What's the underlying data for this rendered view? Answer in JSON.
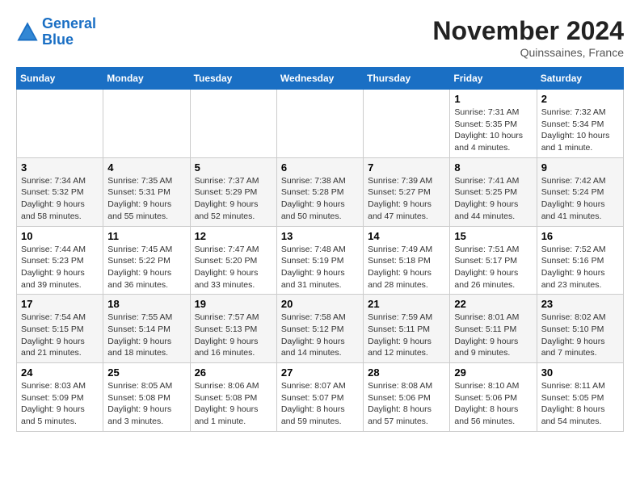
{
  "header": {
    "logo_line1": "General",
    "logo_line2": "Blue",
    "month": "November 2024",
    "location": "Quinssaines, France"
  },
  "weekdays": [
    "Sunday",
    "Monday",
    "Tuesday",
    "Wednesday",
    "Thursday",
    "Friday",
    "Saturday"
  ],
  "weeks": [
    [
      {
        "day": "",
        "info": ""
      },
      {
        "day": "",
        "info": ""
      },
      {
        "day": "",
        "info": ""
      },
      {
        "day": "",
        "info": ""
      },
      {
        "day": "",
        "info": ""
      },
      {
        "day": "1",
        "info": "Sunrise: 7:31 AM\nSunset: 5:35 PM\nDaylight: 10 hours\nand 4 minutes."
      },
      {
        "day": "2",
        "info": "Sunrise: 7:32 AM\nSunset: 5:34 PM\nDaylight: 10 hours\nand 1 minute."
      }
    ],
    [
      {
        "day": "3",
        "info": "Sunrise: 7:34 AM\nSunset: 5:32 PM\nDaylight: 9 hours\nand 58 minutes."
      },
      {
        "day": "4",
        "info": "Sunrise: 7:35 AM\nSunset: 5:31 PM\nDaylight: 9 hours\nand 55 minutes."
      },
      {
        "day": "5",
        "info": "Sunrise: 7:37 AM\nSunset: 5:29 PM\nDaylight: 9 hours\nand 52 minutes."
      },
      {
        "day": "6",
        "info": "Sunrise: 7:38 AM\nSunset: 5:28 PM\nDaylight: 9 hours\nand 50 minutes."
      },
      {
        "day": "7",
        "info": "Sunrise: 7:39 AM\nSunset: 5:27 PM\nDaylight: 9 hours\nand 47 minutes."
      },
      {
        "day": "8",
        "info": "Sunrise: 7:41 AM\nSunset: 5:25 PM\nDaylight: 9 hours\nand 44 minutes."
      },
      {
        "day": "9",
        "info": "Sunrise: 7:42 AM\nSunset: 5:24 PM\nDaylight: 9 hours\nand 41 minutes."
      }
    ],
    [
      {
        "day": "10",
        "info": "Sunrise: 7:44 AM\nSunset: 5:23 PM\nDaylight: 9 hours\nand 39 minutes."
      },
      {
        "day": "11",
        "info": "Sunrise: 7:45 AM\nSunset: 5:22 PM\nDaylight: 9 hours\nand 36 minutes."
      },
      {
        "day": "12",
        "info": "Sunrise: 7:47 AM\nSunset: 5:20 PM\nDaylight: 9 hours\nand 33 minutes."
      },
      {
        "day": "13",
        "info": "Sunrise: 7:48 AM\nSunset: 5:19 PM\nDaylight: 9 hours\nand 31 minutes."
      },
      {
        "day": "14",
        "info": "Sunrise: 7:49 AM\nSunset: 5:18 PM\nDaylight: 9 hours\nand 28 minutes."
      },
      {
        "day": "15",
        "info": "Sunrise: 7:51 AM\nSunset: 5:17 PM\nDaylight: 9 hours\nand 26 minutes."
      },
      {
        "day": "16",
        "info": "Sunrise: 7:52 AM\nSunset: 5:16 PM\nDaylight: 9 hours\nand 23 minutes."
      }
    ],
    [
      {
        "day": "17",
        "info": "Sunrise: 7:54 AM\nSunset: 5:15 PM\nDaylight: 9 hours\nand 21 minutes."
      },
      {
        "day": "18",
        "info": "Sunrise: 7:55 AM\nSunset: 5:14 PM\nDaylight: 9 hours\nand 18 minutes."
      },
      {
        "day": "19",
        "info": "Sunrise: 7:57 AM\nSunset: 5:13 PM\nDaylight: 9 hours\nand 16 minutes."
      },
      {
        "day": "20",
        "info": "Sunrise: 7:58 AM\nSunset: 5:12 PM\nDaylight: 9 hours\nand 14 minutes."
      },
      {
        "day": "21",
        "info": "Sunrise: 7:59 AM\nSunset: 5:11 PM\nDaylight: 9 hours\nand 12 minutes."
      },
      {
        "day": "22",
        "info": "Sunrise: 8:01 AM\nSunset: 5:11 PM\nDaylight: 9 hours\nand 9 minutes."
      },
      {
        "day": "23",
        "info": "Sunrise: 8:02 AM\nSunset: 5:10 PM\nDaylight: 9 hours\nand 7 minutes."
      }
    ],
    [
      {
        "day": "24",
        "info": "Sunrise: 8:03 AM\nSunset: 5:09 PM\nDaylight: 9 hours\nand 5 minutes."
      },
      {
        "day": "25",
        "info": "Sunrise: 8:05 AM\nSunset: 5:08 PM\nDaylight: 9 hours\nand 3 minutes."
      },
      {
        "day": "26",
        "info": "Sunrise: 8:06 AM\nSunset: 5:08 PM\nDaylight: 9 hours\nand 1 minute."
      },
      {
        "day": "27",
        "info": "Sunrise: 8:07 AM\nSunset: 5:07 PM\nDaylight: 8 hours\nand 59 minutes."
      },
      {
        "day": "28",
        "info": "Sunrise: 8:08 AM\nSunset: 5:06 PM\nDaylight: 8 hours\nand 57 minutes."
      },
      {
        "day": "29",
        "info": "Sunrise: 8:10 AM\nSunset: 5:06 PM\nDaylight: 8 hours\nand 56 minutes."
      },
      {
        "day": "30",
        "info": "Sunrise: 8:11 AM\nSunset: 5:05 PM\nDaylight: 8 hours\nand 54 minutes."
      }
    ]
  ]
}
